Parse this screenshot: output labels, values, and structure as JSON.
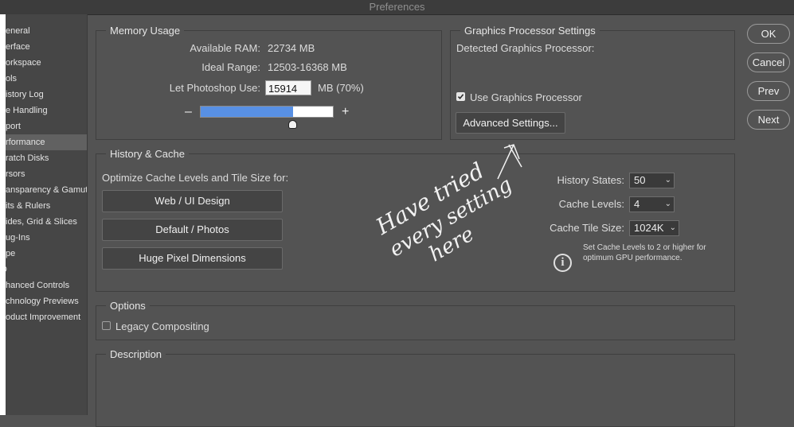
{
  "window": {
    "title": "Preferences"
  },
  "sidebar": {
    "items": [
      {
        "label": "eneral"
      },
      {
        "label": "erface"
      },
      {
        "label": "orkspace"
      },
      {
        "label": "ols"
      },
      {
        "label": "istory Log"
      },
      {
        "label": "e Handling"
      },
      {
        "label": "port"
      },
      {
        "label": "rformance",
        "selected": true
      },
      {
        "label": "ratch Disks"
      },
      {
        "label": "rsors"
      },
      {
        "label": "ansparency & Gamut"
      },
      {
        "label": "its & Rulers"
      },
      {
        "label": "ides, Grid & Slices"
      },
      {
        "label": "ug-Ins"
      },
      {
        "label": "pe"
      },
      {
        "label": "D"
      },
      {
        "label": "hanced Controls"
      },
      {
        "label": "chnology Previews"
      },
      {
        "label": "oduct Improvement"
      }
    ]
  },
  "memory": {
    "title": "Memory Usage",
    "available_label": "Available RAM:",
    "available_value": "22734 MB",
    "ideal_label": "Ideal Range:",
    "ideal_value": "12503-16368 MB",
    "use_label": "Let Photoshop Use:",
    "use_value": "15914",
    "use_suffix": "MB (70%)",
    "minus": "–",
    "plus": "+",
    "slider_fraction": 0.7
  },
  "gpu": {
    "title": "Graphics Processor Settings",
    "detected_label": "Detected Graphics Processor:",
    "use_gpu_label": "Use Graphics Processor",
    "use_gpu_checked": true,
    "advanced_button": "Advanced Settings..."
  },
  "history_cache": {
    "title": "History & Cache",
    "optimize_label": "Optimize Cache Levels and Tile Size for:",
    "buttons": [
      "Web / UI Design",
      "Default / Photos",
      "Huge Pixel Dimensions"
    ],
    "history_states_label": "History States:",
    "history_states_value": "50",
    "cache_levels_label": "Cache Levels:",
    "cache_levels_value": "4",
    "tile_size_label": "Cache Tile Size:",
    "tile_size_value": "1024K",
    "note_line1": "Set Cache Levels to 2 or higher for",
    "note_line2": "optimum GPU performance.",
    "info_icon": "info-icon"
  },
  "options": {
    "title": "Options",
    "legacy_label": "Legacy Compositing",
    "legacy_checked": false
  },
  "description": {
    "title": "Description"
  },
  "dialog_buttons": {
    "ok": "OK",
    "cancel": "Cancel",
    "prev": "Prev",
    "next": "Next"
  },
  "annotation": {
    "line1": "Have tried",
    "line2": "every setting",
    "line3": "here"
  },
  "colors": {
    "background": "#535353",
    "slider_fill": "#5890e4",
    "sidebar_selected": "#616161"
  }
}
